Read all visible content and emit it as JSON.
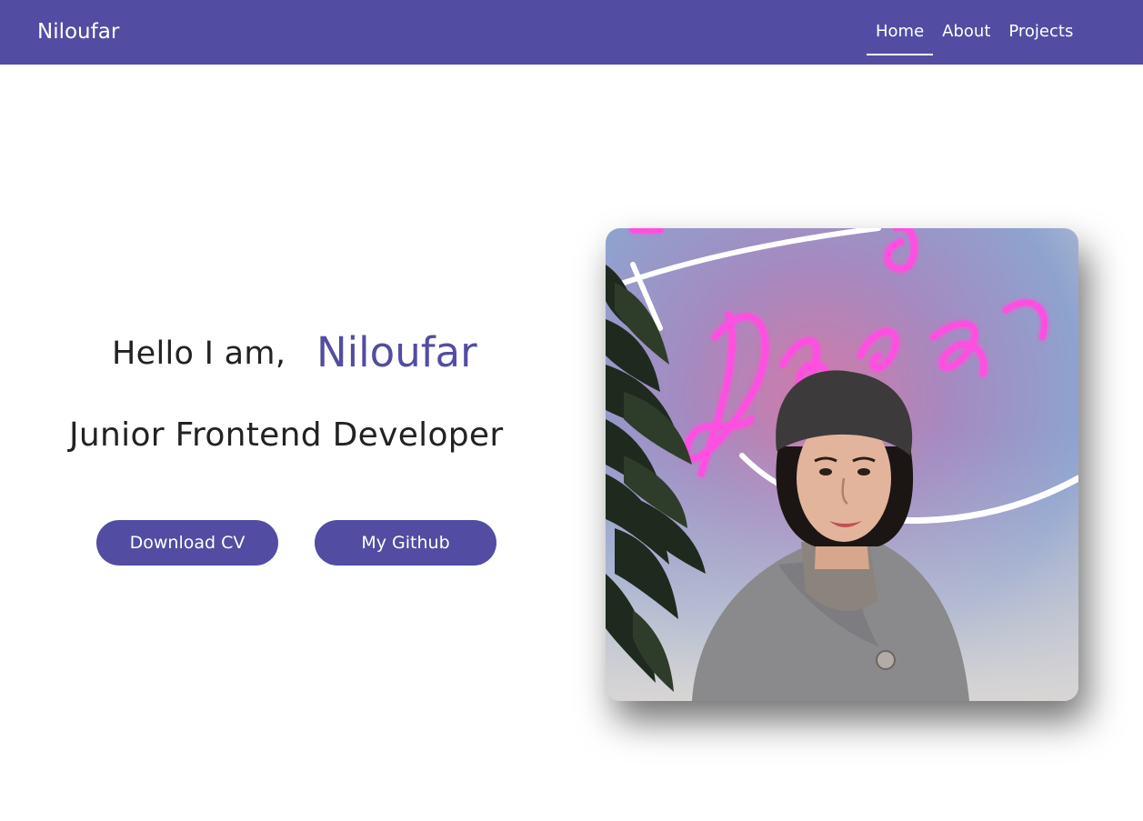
{
  "nav": {
    "brand": "Niloufar",
    "links": [
      {
        "label": "Home",
        "active": true
      },
      {
        "label": "About",
        "active": false
      },
      {
        "label": "Projects",
        "active": false
      }
    ]
  },
  "hero": {
    "greeting": "Hello I am,",
    "name": "Niloufar",
    "role": "Junior Frontend Developer",
    "buttons": {
      "cv_label": "Download CV",
      "github_label": "My Github"
    },
    "photo": {
      "neon_text": "Dream"
    }
  },
  "colors": {
    "accent": "#524da2",
    "text": "#222222",
    "background": "#ffffff"
  }
}
